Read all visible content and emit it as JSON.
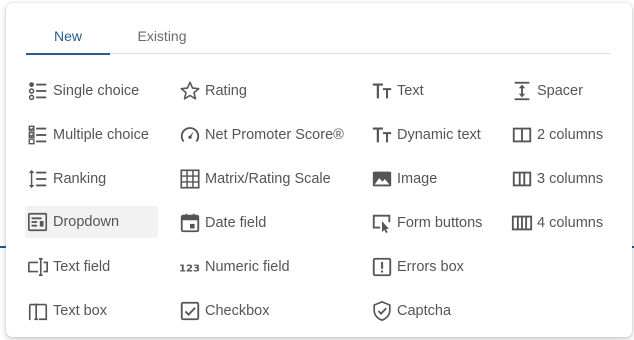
{
  "tabs": [
    {
      "label": "New",
      "active": true
    },
    {
      "label": "Existing",
      "active": false
    }
  ],
  "columns": [
    {
      "items": [
        {
          "label": "Single choice",
          "icon": "single-choice-icon"
        },
        {
          "label": "Multiple choice",
          "icon": "multiple-choice-icon"
        },
        {
          "label": "Ranking",
          "icon": "ranking-icon"
        },
        {
          "label": "Dropdown",
          "icon": "dropdown-icon",
          "highlighted": true
        },
        {
          "label": "Text field",
          "icon": "text-field-icon"
        },
        {
          "label": "Text box",
          "icon": "text-box-icon"
        }
      ]
    },
    {
      "items": [
        {
          "label": "Rating",
          "icon": "star-icon"
        },
        {
          "label": "Net Promoter Score®",
          "icon": "gauge-icon"
        },
        {
          "label": "Matrix/Rating Scale",
          "icon": "grid-icon"
        },
        {
          "label": "Date field",
          "icon": "calendar-icon"
        },
        {
          "label": "Numeric field",
          "icon": "numeric-123-icon"
        },
        {
          "label": "Checkbox",
          "icon": "checkbox-icon"
        }
      ]
    },
    {
      "items": [
        {
          "label": "Text",
          "icon": "text-size-icon"
        },
        {
          "label": "Dynamic text",
          "icon": "dynamic-text-icon"
        },
        {
          "label": "Image",
          "icon": "image-icon"
        },
        {
          "label": "Form buttons",
          "icon": "form-buttons-icon"
        },
        {
          "label": "Errors box",
          "icon": "errors-box-icon"
        },
        {
          "label": "Captcha",
          "icon": "shield-check-icon"
        }
      ]
    },
    {
      "items": [
        {
          "label": "Spacer",
          "icon": "spacer-icon"
        },
        {
          "label": "2 columns",
          "icon": "two-columns-icon"
        },
        {
          "label": "3 columns",
          "icon": "three-columns-icon"
        },
        {
          "label": "4 columns",
          "icon": "four-columns-icon"
        }
      ]
    }
  ],
  "colors": {
    "accent": "#2a5d8f",
    "icon": "#555555",
    "label": "#555555",
    "highlight_bg": "#f2f2f2"
  }
}
